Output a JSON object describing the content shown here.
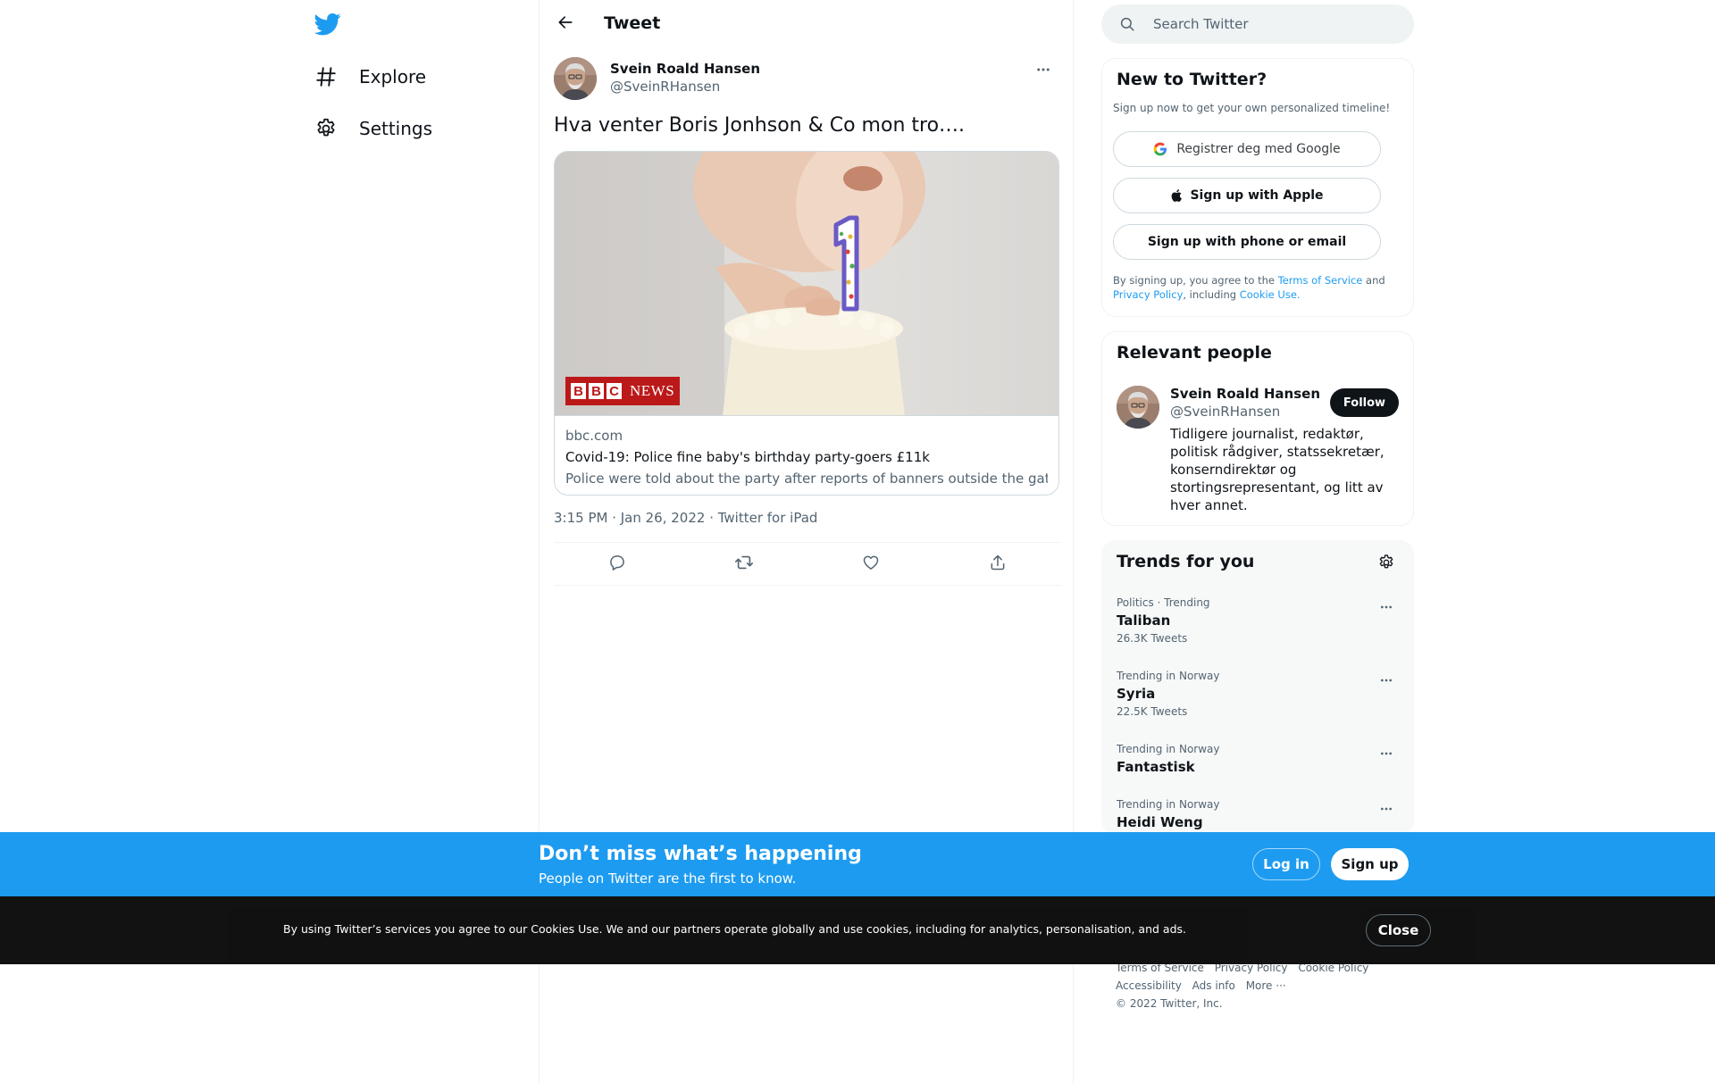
{
  "nav": {
    "explore_label": "Explore",
    "settings_label": "Settings"
  },
  "header": {
    "title": "Tweet"
  },
  "tweet": {
    "author_name": "Svein Roald Hansen",
    "author_handle": "@SveinRHansen",
    "text": "Hva venter Boris Jonhson & Co mon tro….",
    "card": {
      "badge_text": "NEWS",
      "badge_letters": [
        "B",
        "B",
        "C"
      ],
      "domain": "bbc.com",
      "title": "Covid-19: Police fine baby's birthday party-goers £11k",
      "description": "Police were told about the party after reports of banners outside the gathering."
    },
    "meta": "3:15 PM · Jan 26, 2022 · Twitter for iPad"
  },
  "search": {
    "placeholder": "Search Twitter"
  },
  "new_to_twitter": {
    "title": "New to Twitter?",
    "subtitle": "Sign up now to get your own personalized timeline!",
    "google_label": "Registrer deg med Google",
    "apple_label": "Sign up with Apple",
    "phone_label": "Sign up with phone or email",
    "legal_prefix": "By signing up, you agree to the ",
    "terms": "Terms of Service",
    "and": " and ",
    "privacy": "Privacy Policy",
    "including": ", including ",
    "cookie": "Cookie Use."
  },
  "relevant_people": {
    "title": "Relevant people",
    "name": "Svein Roald Hansen",
    "handle": "@SveinRHansen",
    "follow_label": "Follow",
    "bio": "Tidligere journalist, redaktør, politisk rådgiver, statssekretær, konserndirektør og stortingsrepresentant, og litt av hver annet."
  },
  "trends": {
    "title": "Trends for you",
    "items": [
      {
        "context": "Politics · Trending",
        "name": "Taliban",
        "count": "26.3K Tweets"
      },
      {
        "context": "Trending in Norway",
        "name": "Syria",
        "count": "22.5K Tweets"
      },
      {
        "context": "Trending in Norway",
        "name": "Fantastisk",
        "count": ""
      },
      {
        "context": "Trending in Norway",
        "name": "Heidi Weng",
        "count": ""
      }
    ]
  },
  "footer": {
    "terms": "Terms of Service",
    "privacy": "Privacy Policy",
    "cookie": "Cookie Policy",
    "accessibility": "Accessibility",
    "ads": "Ads info",
    "more": "More ···",
    "copyright": "© 2022 Twitter, Inc."
  },
  "signup_bar": {
    "title": "Don’t miss what’s happening",
    "subtitle": "People on Twitter are the first to know.",
    "login_label": "Log in",
    "signup_label": "Sign up"
  },
  "cookie_bar": {
    "text": "By using Twitter’s services you agree to our Cookies Use. We and our partners operate globally and use cookies, including for analytics, personalisation, and ads.",
    "close_label": "Close"
  },
  "colors": {
    "brand": "#1d9bf0",
    "text": "#0f1419",
    "secondary": "#536471",
    "bbc_red": "#bb1919"
  }
}
